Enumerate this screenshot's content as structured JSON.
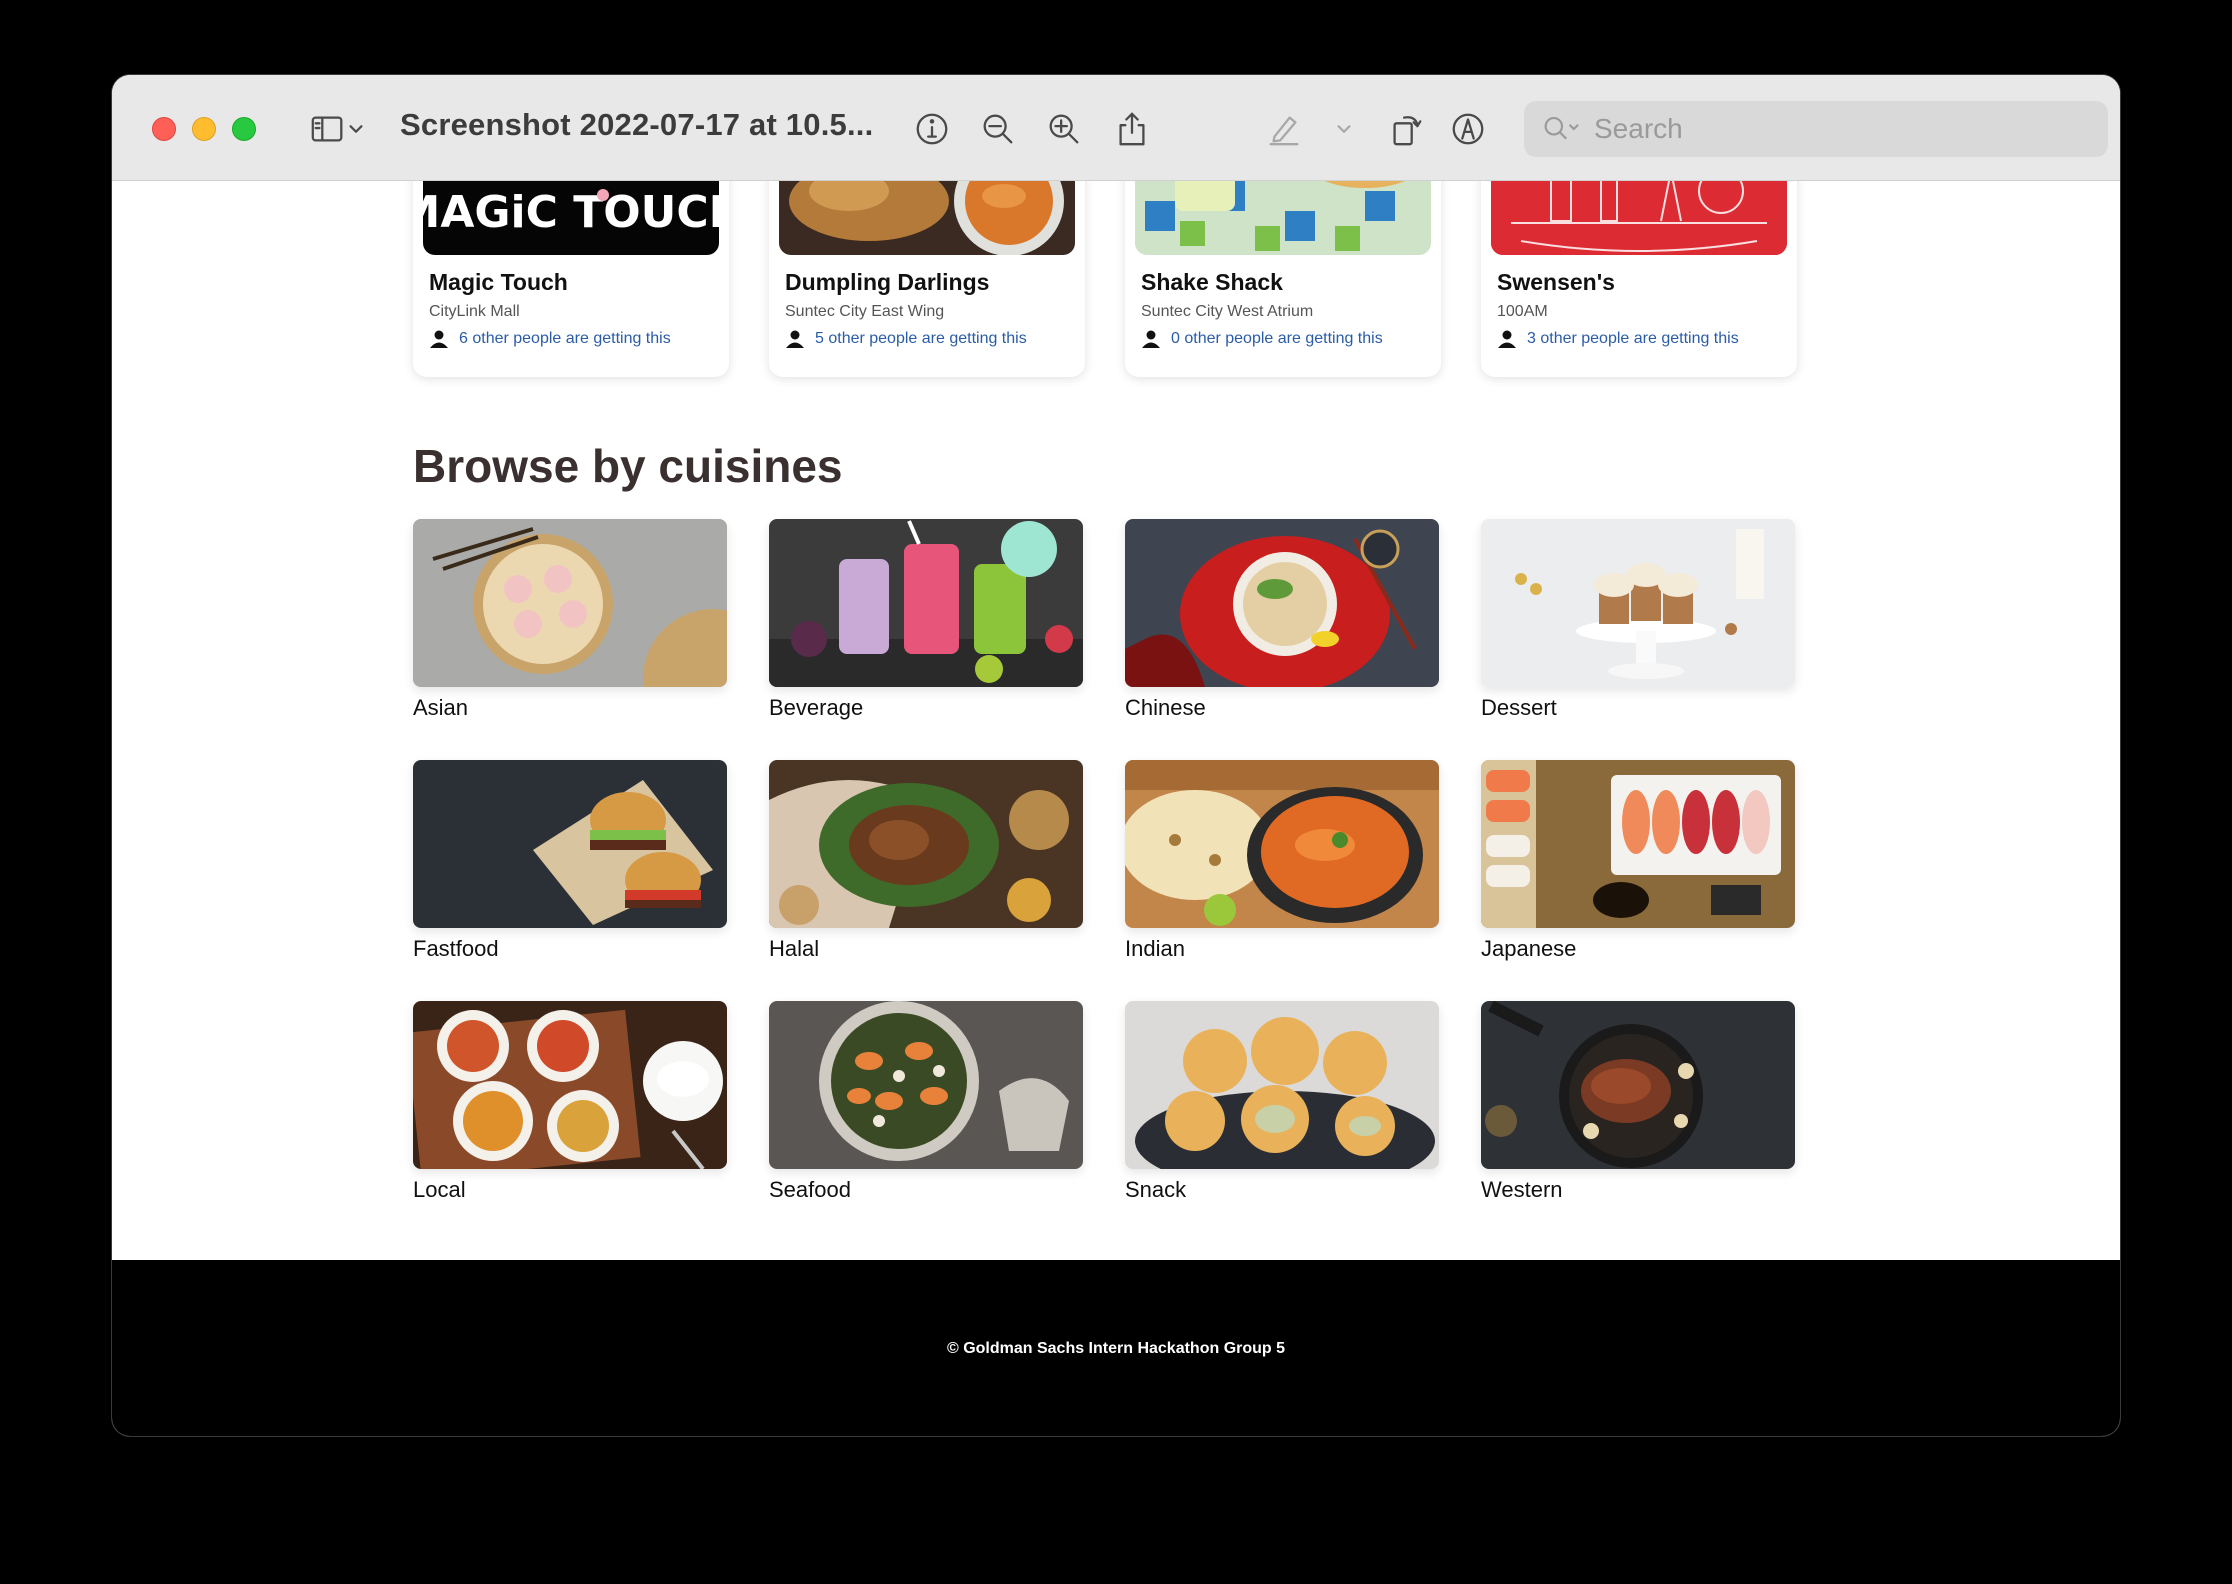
{
  "window": {
    "title": "Screenshot 2022-07-17 at 10.5...",
    "search_placeholder": "Search"
  },
  "deals": [
    {
      "name": "Magic Touch",
      "location": "CityLink Mall",
      "people": "6 other people are getting this",
      "image": "magic-touch-logo",
      "logo_text": "MAGiC TOUCH"
    },
    {
      "name": "Dumpling Darlings",
      "location": "Suntec City East Wing",
      "people": "5 other people are getting this",
      "image": "dumplings-photo"
    },
    {
      "name": "Shake Shack",
      "location": "Suntec City West Atrium",
      "people": "0 other people are getting this",
      "image": "shake-shack-photo"
    },
    {
      "name": "Swensen's",
      "location": "100AM",
      "people": "3 other people are getting this",
      "image": "swensens-logo"
    }
  ],
  "cuisines_section": {
    "title": "Browse by cuisines",
    "items": [
      {
        "label": "Asian",
        "image": "dim-sum-photo"
      },
      {
        "label": "Beverage",
        "image": "smoothies-photo"
      },
      {
        "label": "Chinese",
        "image": "noodle-bowl-photo"
      },
      {
        "label": "Dessert",
        "image": "cupcakes-photo"
      },
      {
        "label": "Fastfood",
        "image": "burgers-photo"
      },
      {
        "label": "Halal",
        "image": "roast-duck-photo"
      },
      {
        "label": "Indian",
        "image": "curry-naan-photo"
      },
      {
        "label": "Japanese",
        "image": "sushi-photo"
      },
      {
        "label": "Local",
        "image": "curry-rice-photo"
      },
      {
        "label": "Seafood",
        "image": "shrimp-bowl-photo"
      },
      {
        "label": "Snack",
        "image": "buns-photo"
      },
      {
        "label": "Western",
        "image": "steak-pan-photo"
      }
    ]
  },
  "footer": {
    "text": "© Goldman Sachs Intern Hackathon Group 5"
  }
}
